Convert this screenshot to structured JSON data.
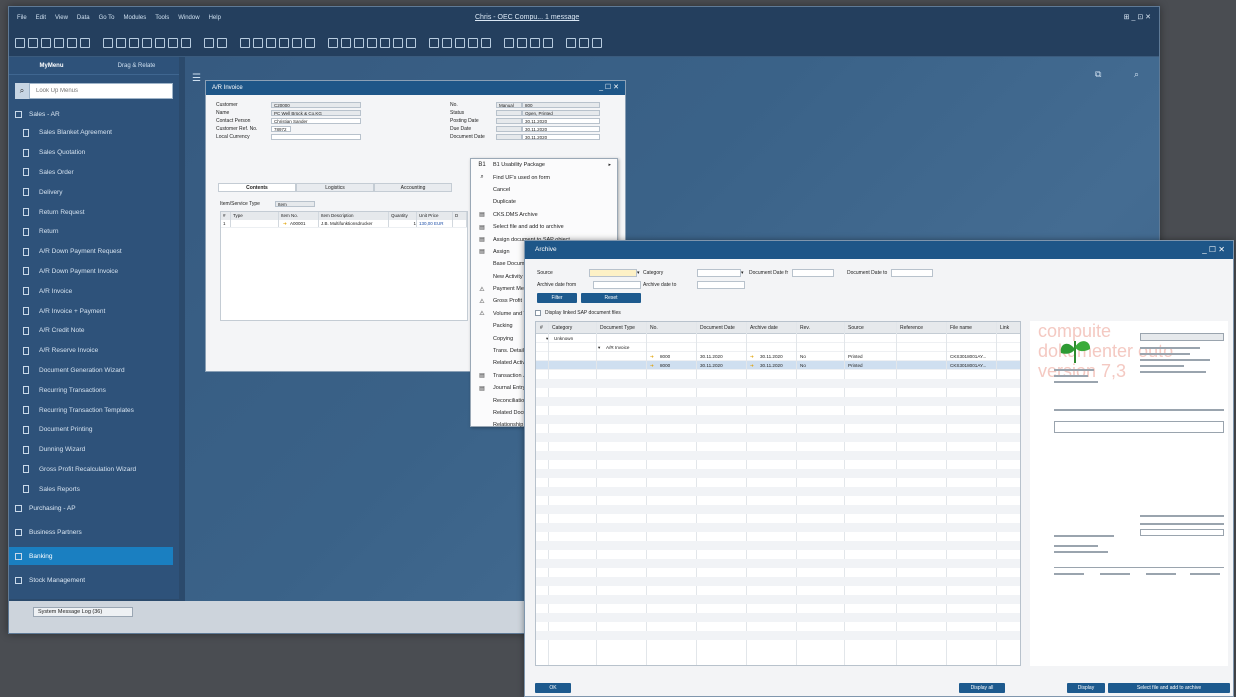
{
  "app": {
    "title": "Chris - OEC Compu... 1 message",
    "menu": [
      "File",
      "Edit",
      "View",
      "Data",
      "Go To",
      "Modules",
      "Tools",
      "Window",
      "Help"
    ],
    "window_controls": "⊞ _ ⊡ ✕"
  },
  "left_panel": {
    "tabs": [
      "MyMenu",
      "Drag & Relate"
    ],
    "search_placeholder": "Look Up Menus",
    "sales_header": "Sales - AR",
    "sales_items": [
      "Sales Blanket Agreement",
      "Sales Quotation",
      "Sales Order",
      "Delivery",
      "Return Request",
      "Return",
      "A/R Down Payment Request",
      "A/R Down Payment Invoice",
      "A/R Invoice",
      "A/R Invoice + Payment",
      "A/R Credit Note",
      "A/R Reserve Invoice",
      "Document Generation Wizard",
      "Recurring Transactions",
      "Recurring Transaction Templates",
      "Document Printing",
      "Dunning Wizard",
      "Gross Profit Recalculation Wizard",
      "Sales Reports"
    ],
    "modules": [
      "Purchasing - AP",
      "Business Partners",
      "Banking",
      "Stock Management"
    ]
  },
  "status": {
    "tab_label": "System Message Log (36)"
  },
  "ar_invoice": {
    "title": "A/R Invoice",
    "window_controls": "_ ☐ ✕",
    "left_fields": [
      {
        "label": "Customer",
        "value": "C20000"
      },
      {
        "label": "Name",
        "value": "PC Well Brück & Co.KG"
      },
      {
        "label": "Contact Person",
        "value": "Christian Sander"
      },
      {
        "label": "Customer Ref. No.",
        "value": "78972"
      },
      {
        "label": "Local Currency",
        "value": ""
      }
    ],
    "right_fields": [
      {
        "label": "No.",
        "value1": "Manual",
        "value2": "800"
      },
      {
        "label": "Status",
        "value1": "",
        "value2": "Open, Printed"
      },
      {
        "label": "Posting Date",
        "value1": "",
        "value2": "30.11.2020"
      },
      {
        "label": "Due Date",
        "value1": "",
        "value2": "30.11.2020"
      },
      {
        "label": "Document Date",
        "value1": "",
        "value2": "30.11.2020"
      }
    ],
    "tabs": [
      "Contents",
      "Logistics",
      "Accounting"
    ],
    "item_service_label": "Item/Service Type",
    "item_service_value": "Item",
    "grid_headers": [
      "#",
      "Type",
      "Item No.",
      "Item Description",
      "Quantity",
      "Unit Price",
      "D"
    ],
    "grid_rows": [
      [
        "1",
        "",
        "A00001",
        "J.B. Multifunktionsdrucker",
        "1",
        "130,00 EUR",
        ""
      ]
    ]
  },
  "context_menu": {
    "items": [
      {
        "label": "B1 Usability Package",
        "icon": "B1",
        "arrow": "▸"
      },
      {
        "label": "Find UF's used on form",
        "icon": "⌕",
        "arrow": ""
      },
      {
        "label": "Cancel",
        "icon": "",
        "arrow": ""
      },
      {
        "label": "Duplicate",
        "icon": "",
        "arrow": ""
      },
      {
        "label": "CKS.DMS Archive",
        "icon": "▤",
        "arrow": ""
      },
      {
        "label": "Select file and add to archive",
        "icon": "▤",
        "arrow": ""
      },
      {
        "label": "Assign document to SAP object",
        "icon": "▤",
        "arrow": ""
      },
      {
        "label": "Assign",
        "icon": "▤",
        "arrow": ""
      },
      {
        "label": "Base Document",
        "icon": "",
        "arrow": ""
      },
      {
        "label": "New Activity",
        "icon": "",
        "arrow": ""
      },
      {
        "label": "Payment Means",
        "icon": "⚠",
        "arrow": ""
      },
      {
        "label": "Gross Profit",
        "icon": "⚠",
        "arrow": ""
      },
      {
        "label": "Volume and Weight",
        "icon": "⚠",
        "arrow": ""
      },
      {
        "label": "Packing",
        "icon": "",
        "arrow": ""
      },
      {
        "label": "Copying",
        "icon": "",
        "arrow": ""
      },
      {
        "label": "Trans. Details",
        "icon": "",
        "arrow": ""
      },
      {
        "label": "Related Activities",
        "icon": "",
        "arrow": ""
      },
      {
        "label": "Transaction Journal",
        "icon": "▤",
        "arrow": ""
      },
      {
        "label": "Journal Entry",
        "icon": "▤",
        "arrow": ""
      },
      {
        "label": "Reconciliation",
        "icon": "",
        "arrow": ""
      },
      {
        "label": "Related Documents",
        "icon": "",
        "arrow": ""
      },
      {
        "label": "Relationship Map",
        "icon": "",
        "arrow": ""
      }
    ]
  },
  "archive": {
    "title": "Archive",
    "window_controls": "_ ☐ ✕",
    "filters": {
      "source": "Source",
      "category": "Category",
      "doc_date_from": "Document Date fr",
      "doc_date_to": "Document Date to",
      "archive_date_from": "Archive date from",
      "archive_date_to": "Archive date to"
    },
    "filter_btn": "Filter",
    "reset_btn": "Reset",
    "display_linked": "Display linked SAP document files",
    "headers": [
      "#",
      "Category",
      "Document Type",
      "No.",
      "Document Date",
      "Archive date",
      "Rev.",
      "Source",
      "Reference",
      "File name",
      "Link"
    ],
    "group1": "Unknown",
    "group2": "A/R Invoice",
    "rows": [
      {
        "no": "8000",
        "doc_date": "30.11.2020",
        "arch_date": "30.11.2020",
        "rev": "No",
        "source": "Printed",
        "file": "CKS3018001AY..."
      },
      {
        "no": "8000",
        "doc_date": "30.11.2020",
        "arch_date": "30.11.2020",
        "rev": "No",
        "source": "Printed",
        "file": "CKS3018001AY..."
      }
    ],
    "watermark": [
      "compuite",
      "dokumenter outo",
      "version 7,3"
    ],
    "ok_btn": "OK",
    "display_all_btn": "Display all",
    "display_btn": "Display",
    "select_add_btn": "Select file and add to archive"
  },
  "colors": {
    "accent": "#1d5a8e",
    "selected_module": "#1a7fc1",
    "titlebar": "#1e5688"
  }
}
